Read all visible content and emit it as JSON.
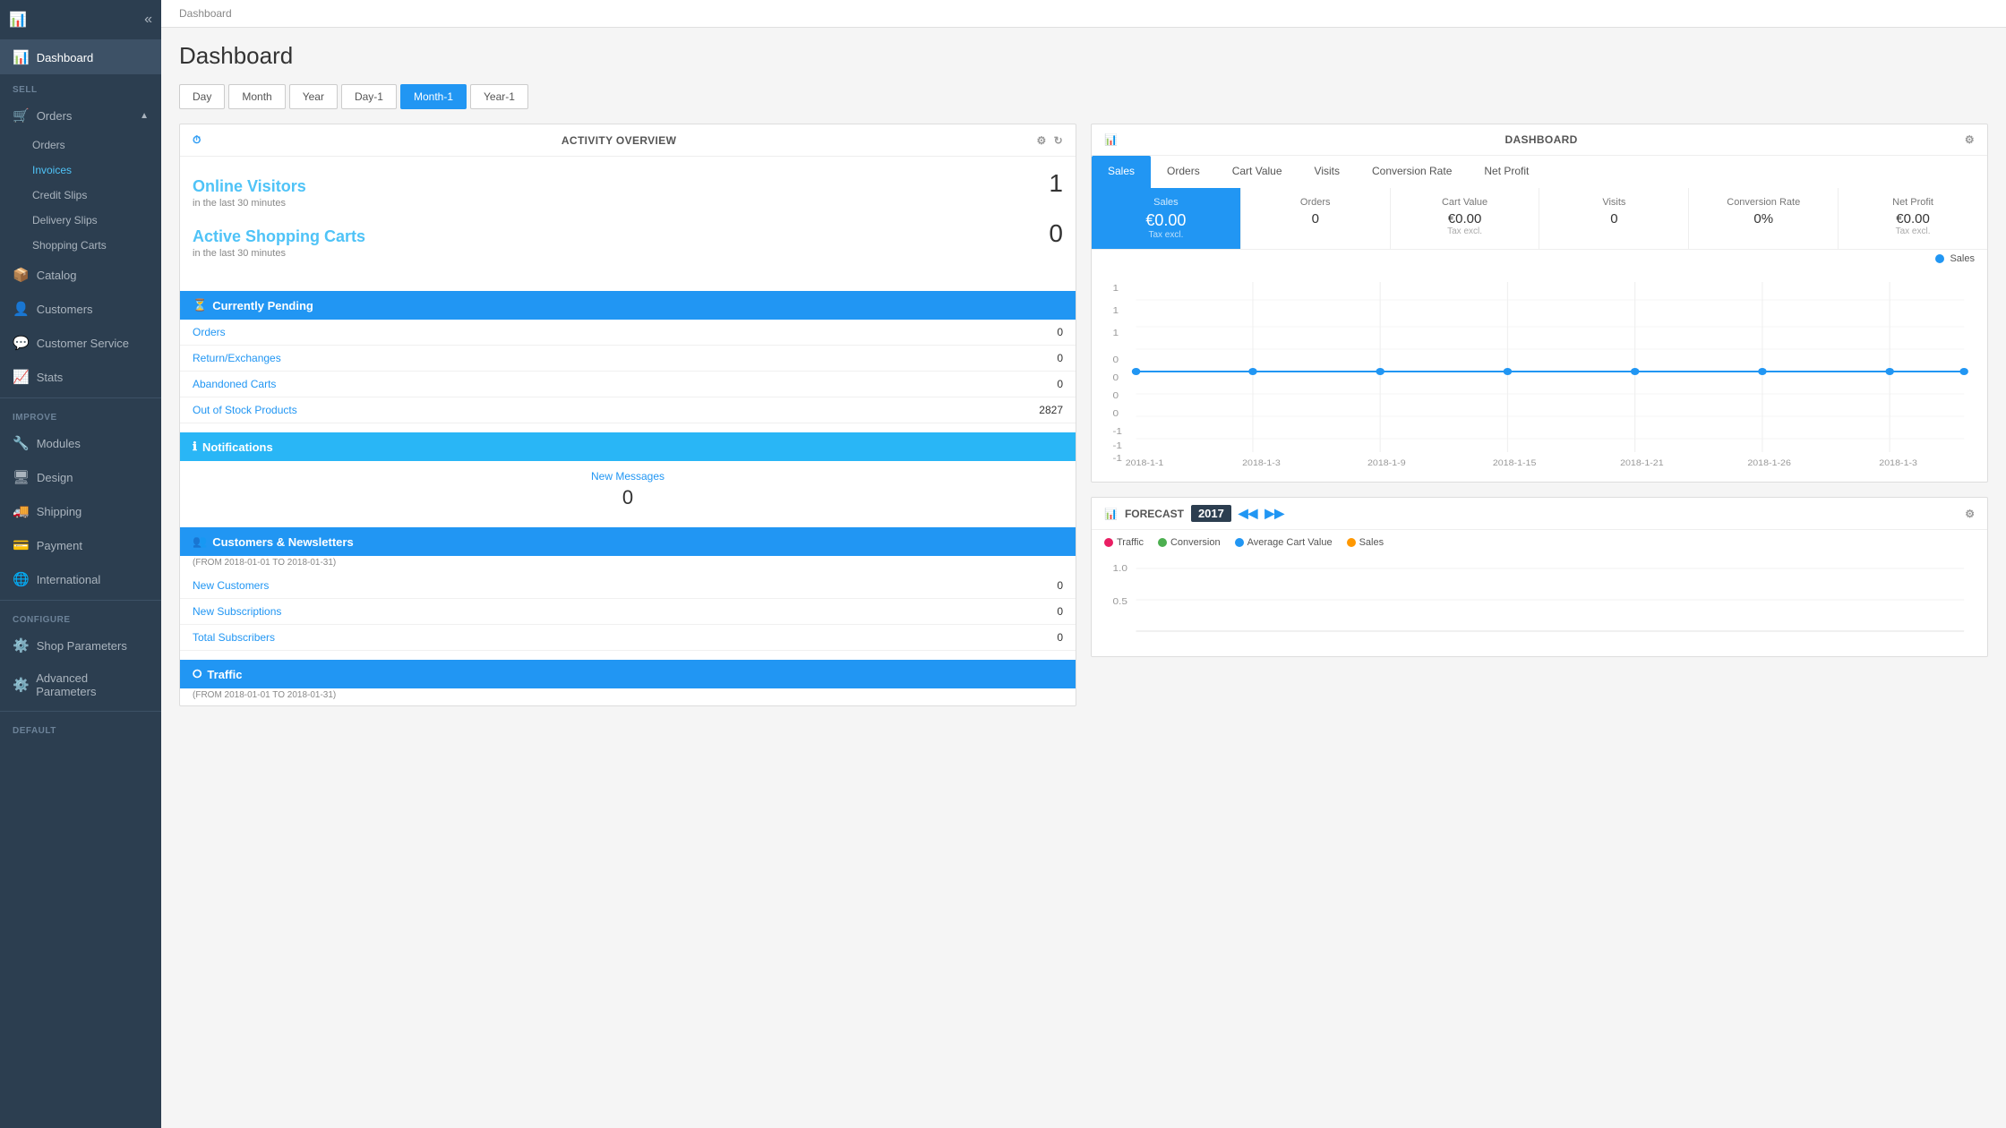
{
  "sidebar": {
    "toggle_label": "«",
    "sections": [
      {
        "label": "",
        "items": [
          {
            "id": "dashboard",
            "label": "Dashboard",
            "icon": "📊",
            "active": true
          }
        ]
      },
      {
        "label": "SELL",
        "items": [
          {
            "id": "orders",
            "label": "Orders",
            "icon": "🛒",
            "expanded": true,
            "subitems": [
              {
                "id": "orders-sub",
                "label": "Orders"
              },
              {
                "id": "invoices",
                "label": "Invoices",
                "active": true
              },
              {
                "id": "credit-slips",
                "label": "Credit Slips"
              },
              {
                "id": "delivery-slips",
                "label": "Delivery Slips"
              },
              {
                "id": "shopping-carts",
                "label": "Shopping Carts"
              }
            ]
          },
          {
            "id": "catalog",
            "label": "Catalog",
            "icon": "📦"
          },
          {
            "id": "customers",
            "label": "Customers",
            "icon": "👤"
          },
          {
            "id": "customer-service",
            "label": "Customer Service",
            "icon": "💬"
          },
          {
            "id": "stats",
            "label": "Stats",
            "icon": "📈"
          }
        ]
      },
      {
        "label": "IMPROVE",
        "items": [
          {
            "id": "modules",
            "label": "Modules",
            "icon": "🔧"
          },
          {
            "id": "design",
            "label": "Design",
            "icon": "🖥"
          },
          {
            "id": "shipping",
            "label": "Shipping",
            "icon": "🚚"
          },
          {
            "id": "payment",
            "label": "Payment",
            "icon": "💳"
          },
          {
            "id": "international",
            "label": "International",
            "icon": "🌐"
          }
        ]
      },
      {
        "label": "CONFIGURE",
        "items": [
          {
            "id": "shop-parameters",
            "label": "Shop Parameters",
            "icon": "⚙️"
          },
          {
            "id": "advanced-parameters",
            "label": "Advanced Parameters",
            "icon": "⚙️"
          }
        ]
      },
      {
        "label": "DEFAULT",
        "items": []
      }
    ]
  },
  "breadcrumb": "Dashboard",
  "page_title": "Dashboard",
  "date_tabs": [
    {
      "id": "day",
      "label": "Day",
      "active": false
    },
    {
      "id": "month",
      "label": "Month",
      "active": false
    },
    {
      "id": "year",
      "label": "Year",
      "active": false
    },
    {
      "id": "day-1",
      "label": "Day-1",
      "active": false
    },
    {
      "id": "month-1",
      "label": "Month-1",
      "active": true
    },
    {
      "id": "year-1",
      "label": "Year-1",
      "active": false
    }
  ],
  "activity_overview": {
    "title": "ACTIVITY OVERVIEW",
    "online_visitors_label": "Online Visitors",
    "online_visitors_count": "1",
    "online_visitors_sub": "in the last 30 minutes",
    "active_carts_label": "Active Shopping Carts",
    "active_carts_count": "0",
    "active_carts_sub": "in the last 30 minutes",
    "pending_section": "Currently Pending",
    "pending_rows": [
      {
        "label": "Orders",
        "value": "0"
      },
      {
        "label": "Return/Exchanges",
        "value": "0"
      },
      {
        "label": "Abandoned Carts",
        "value": "0"
      },
      {
        "label": "Out of Stock Products",
        "value": "2827"
      }
    ],
    "notifications_section": "Notifications",
    "notifications_link": "New Messages",
    "notifications_count": "0",
    "cnl_section": "Customers & Newsletters",
    "cnl_date": "(FROM 2018-01-01 TO 2018-01-31)",
    "cnl_rows": [
      {
        "label": "New Customers",
        "value": "0"
      },
      {
        "label": "New Subscriptions",
        "value": "0"
      },
      {
        "label": "Total Subscribers",
        "value": "0"
      }
    ],
    "traffic_section": "Traffic",
    "traffic_date": "(FROM 2018-01-01 TO 2018-01-31)"
  },
  "dashboard_panel": {
    "title": "DASHBOARD",
    "tabs": [
      {
        "id": "sales",
        "label": "Sales",
        "active": true
      },
      {
        "id": "orders",
        "label": "Orders"
      },
      {
        "id": "cart-value",
        "label": "Cart Value"
      },
      {
        "id": "visits",
        "label": "Visits"
      },
      {
        "id": "conversion-rate",
        "label": "Conversion Rate"
      },
      {
        "id": "net-profit",
        "label": "Net Profit"
      }
    ],
    "sales_value": "€0.00",
    "sales_sub": "Tax excl.",
    "orders_value": "0",
    "cart_value": "€0.00",
    "cart_sub": "Tax excl.",
    "visits_value": "0",
    "conversion_rate": "0%",
    "net_profit": "€0.00",
    "net_profit_sub": "Tax excl.",
    "legend_sales": "Sales",
    "chart_x_labels": [
      "2018-1-1",
      "2018-1-3",
      "2018-1-9",
      "2018-1-15",
      "2018-1-21",
      "2018-1-26",
      "2018-1-3"
    ],
    "chart_y_labels": [
      "1",
      "1",
      "1",
      "0",
      "0",
      "0",
      "0",
      "-1",
      "-1",
      "-1"
    ]
  },
  "forecast_panel": {
    "title": "FORECAST",
    "year": "2017",
    "legend": [
      {
        "label": "Traffic",
        "color": "#e91e63"
      },
      {
        "label": "Conversion",
        "color": "#4caf50"
      },
      {
        "label": "Average Cart Value",
        "color": "#2196f3"
      },
      {
        "label": "Sales",
        "color": "#ff9800"
      }
    ],
    "chart_y_labels": [
      "1.0",
      "0.5"
    ]
  },
  "colors": {
    "primary": "#2196f3",
    "sidebar_bg": "#2c3e50",
    "active_tab": "#2196f3"
  }
}
